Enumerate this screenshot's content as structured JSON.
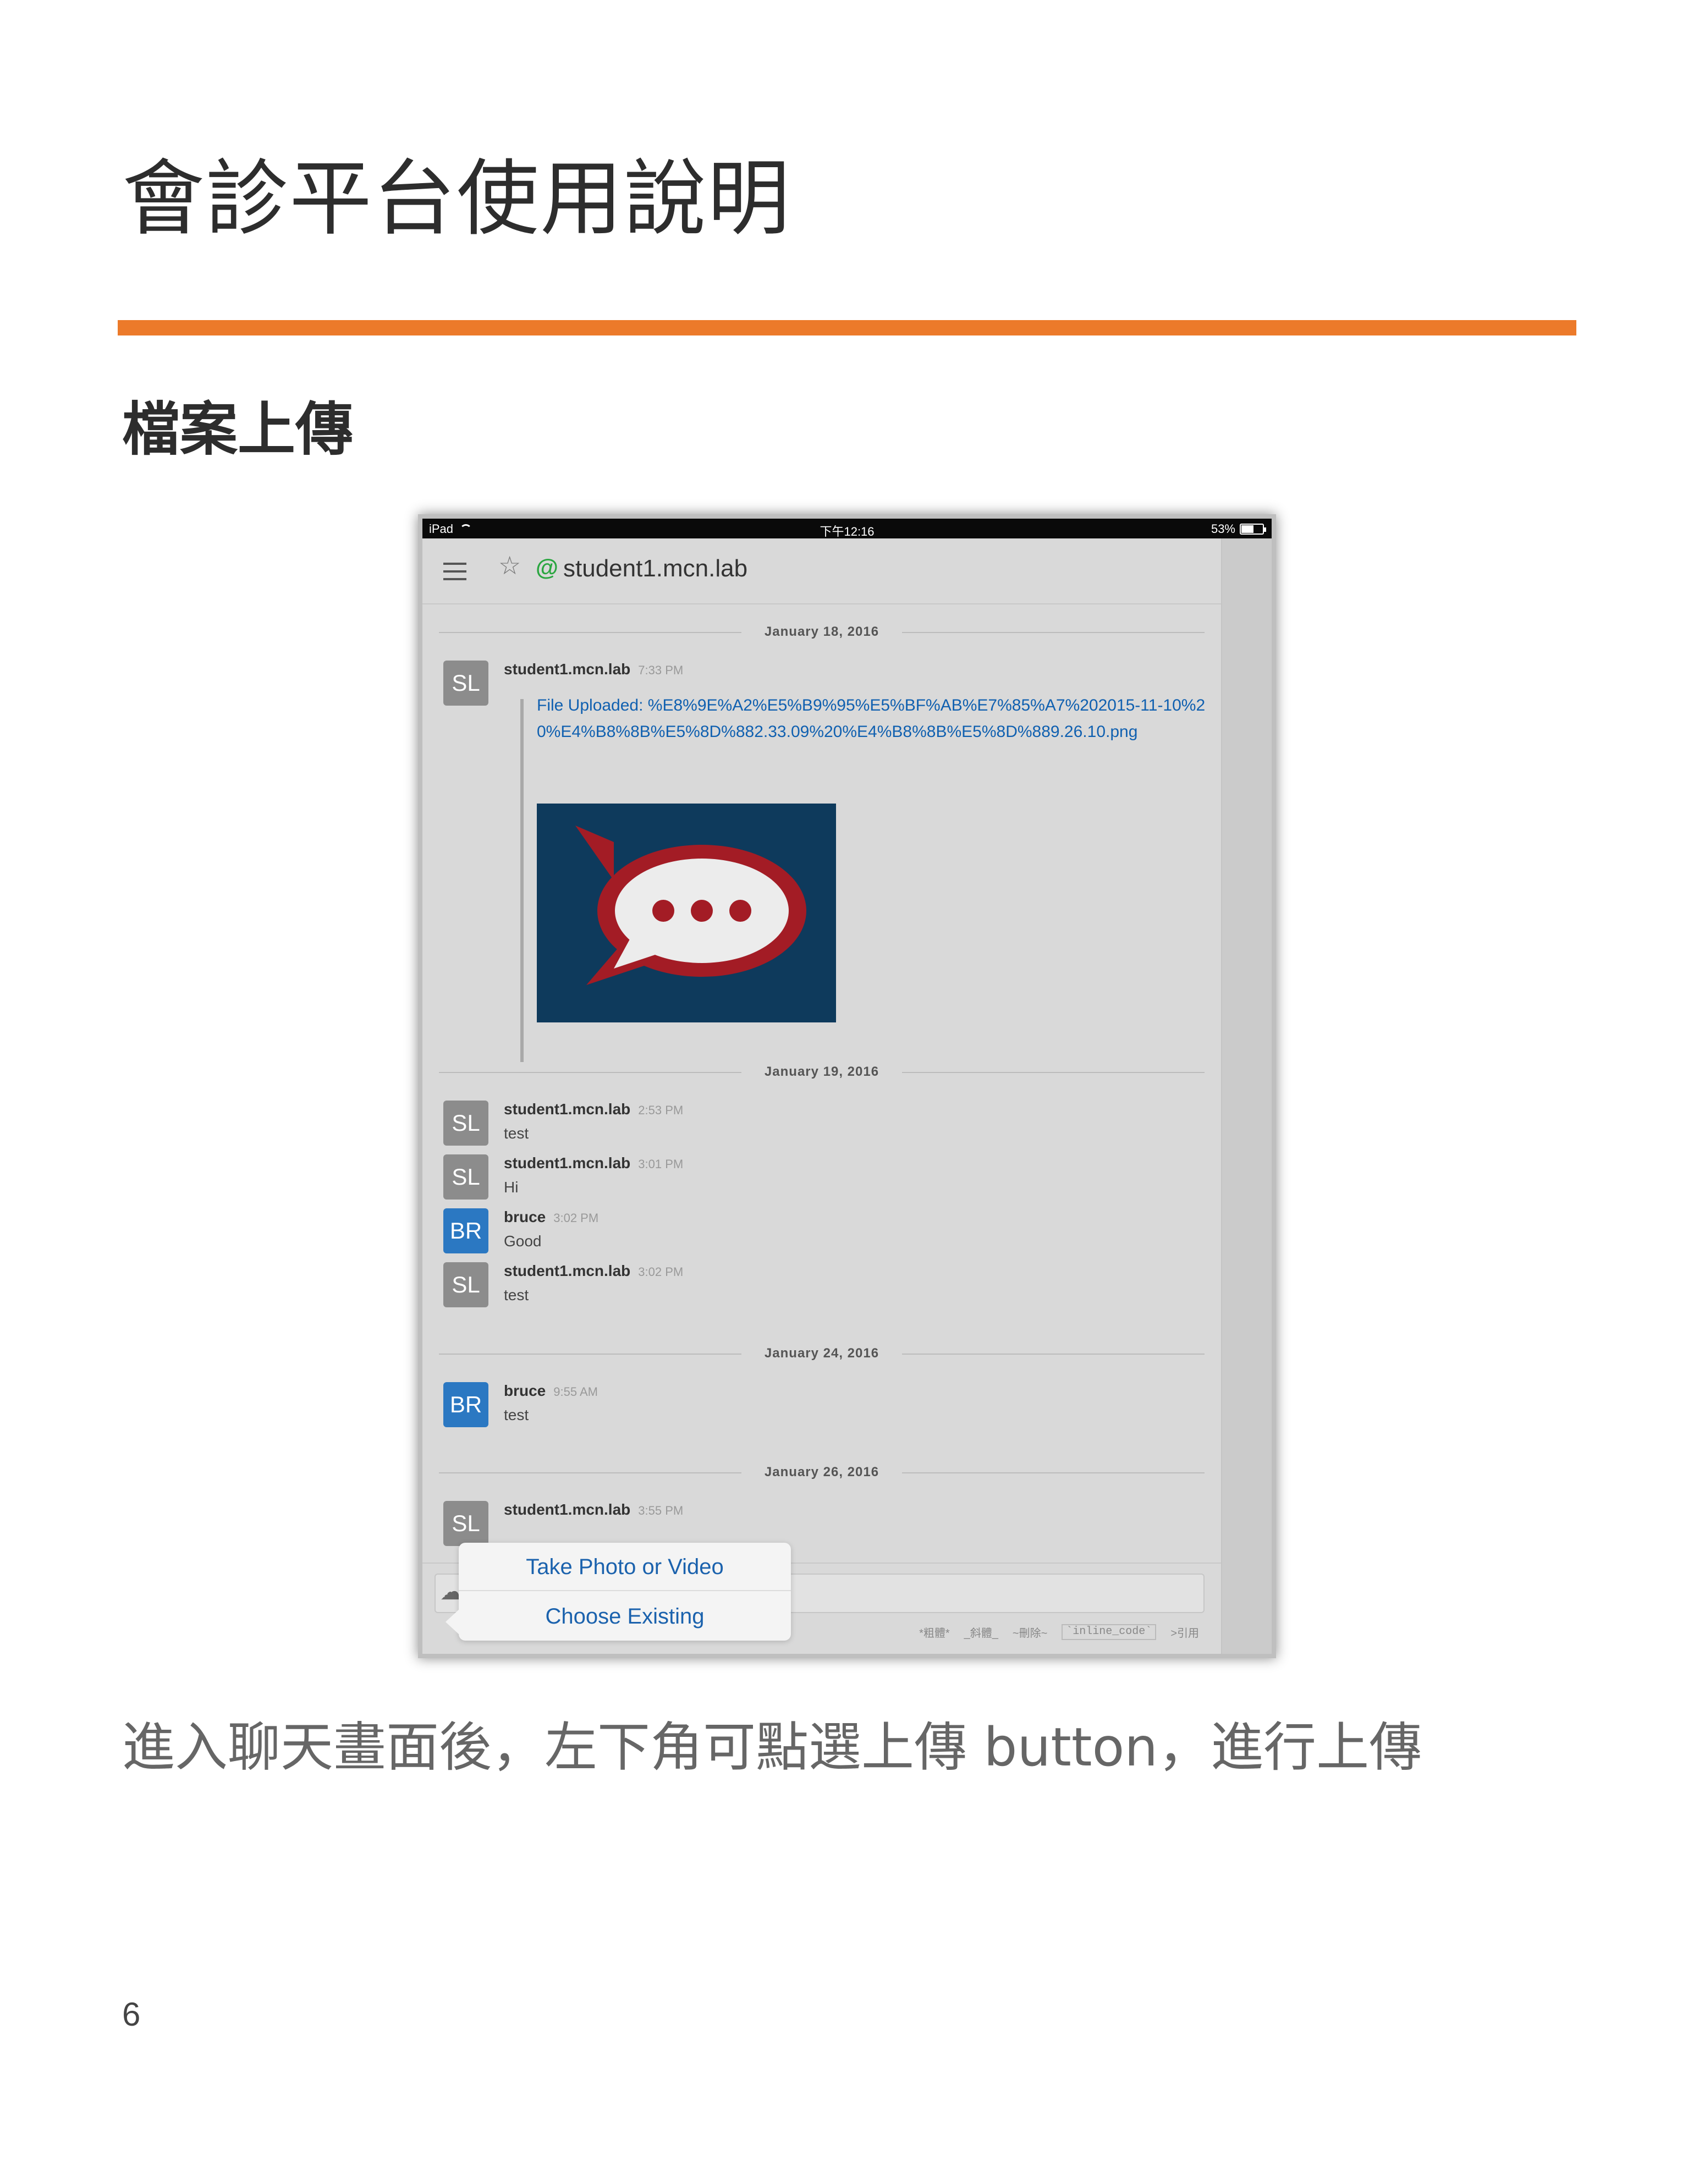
{
  "document": {
    "title": "會診平台使用說明",
    "section_title": "檔案上傳",
    "caption": "進入聊天畫面後，左下角可點選上傳 button，進行上傳",
    "page_number": "6",
    "accent_color": "#ec7a2a"
  },
  "screenshot": {
    "status_bar": {
      "device": "iPad",
      "time": "下午12:16",
      "battery": "53%"
    },
    "header": {
      "room_name": "student1.mcn.lab",
      "star_icon": "star-icon",
      "at_icon": "@"
    },
    "date_separators": [
      "January 18, 2016",
      "January 19, 2016",
      "January 24, 2016",
      "January 26, 2016"
    ],
    "messages": [
      {
        "initials": "SL",
        "user": "student1.mcn.lab",
        "time": "7:33 PM",
        "text": "File Uploaded: %E8%9E%A2%E5%B9%95%E5%BF%AB%E7%85%A7%202015-11-10%20%E4%B8%8B%E5%8D%882.33.09%20%E4%B8%8B%E5%8D%889.26.10.png"
      },
      {
        "initials": "SL",
        "user": "student1.mcn.lab",
        "time": "2:53 PM",
        "text": "test"
      },
      {
        "initials": "SL",
        "user": "student1.mcn.lab",
        "time": "3:01 PM",
        "text": "Hi"
      },
      {
        "initials": "BR",
        "user": "bruce",
        "time": "3:02 PM",
        "text": "Good"
      },
      {
        "initials": "SL",
        "user": "student1.mcn.lab",
        "time": "3:02 PM",
        "text": "test"
      },
      {
        "initials": "BR",
        "user": "bruce",
        "time": "9:55 AM",
        "text": "test"
      },
      {
        "initials": "SL",
        "user": "student1.mcn.lab",
        "time": "3:55 PM",
        "text": ""
      }
    ],
    "action_sheet": {
      "take_photo": "Take Photo or Video",
      "choose_existing": "Choose Existing"
    },
    "format_hints": {
      "bold": "*粗體*",
      "italic": "_斜體_",
      "strike": "~刪除~",
      "code": "`inline_code`",
      "quote": ">引用"
    },
    "colors": {
      "link": "#1060b0",
      "avatar_sl": "#8c8c8c",
      "avatar_br": "#2b78c2",
      "image_bg": "#0e3a5c"
    }
  }
}
